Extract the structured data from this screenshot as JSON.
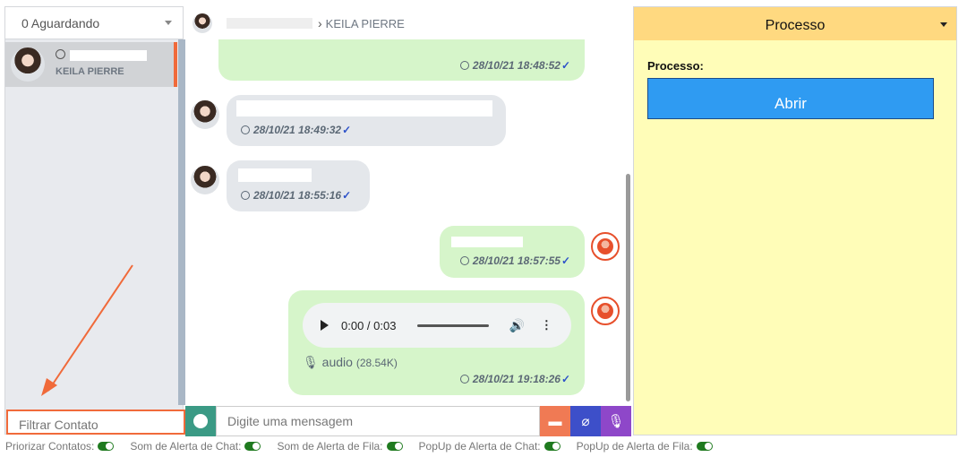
{
  "left": {
    "waiting": "0 Aguardando",
    "contact_name": "KEILA PIERRE",
    "filter_placeholder": "Filtrar Contato"
  },
  "chat": {
    "header_name": "KEILA PIERRE",
    "messages": [
      {
        "timestamp": "28/10/21 18:48:52",
        "direction": "out"
      },
      {
        "timestamp": "28/10/21 18:49:32",
        "direction": "in"
      },
      {
        "timestamp": "28/10/21 18:55:16",
        "direction": "in"
      },
      {
        "timestamp": "28/10/21 18:57:55",
        "direction": "out"
      },
      {
        "timestamp": "28/10/21 19:18:26",
        "direction": "out",
        "audio": {
          "time": "0:00 / 0:03",
          "label": "audio",
          "size": "(28.54K)"
        }
      }
    ],
    "input_placeholder": "Digite uma mensagem"
  },
  "right": {
    "header": "Processo",
    "label": "Processo:",
    "button": "Abrir"
  },
  "footer": {
    "options": [
      "Priorizar Contatos:",
      "Som de Alerta de Chat:",
      "Som de Alerta de Fila:",
      "PopUp de Alerta de Chat:",
      "PopUp de Alerta de Fila:"
    ]
  },
  "colors": {
    "accent": "#f06a3a",
    "out_bubble": "#d6f5ca",
    "in_bubble": "#e4e7eb",
    "button": "#2f9bf2",
    "panel_yellow": "#fffdb8"
  }
}
